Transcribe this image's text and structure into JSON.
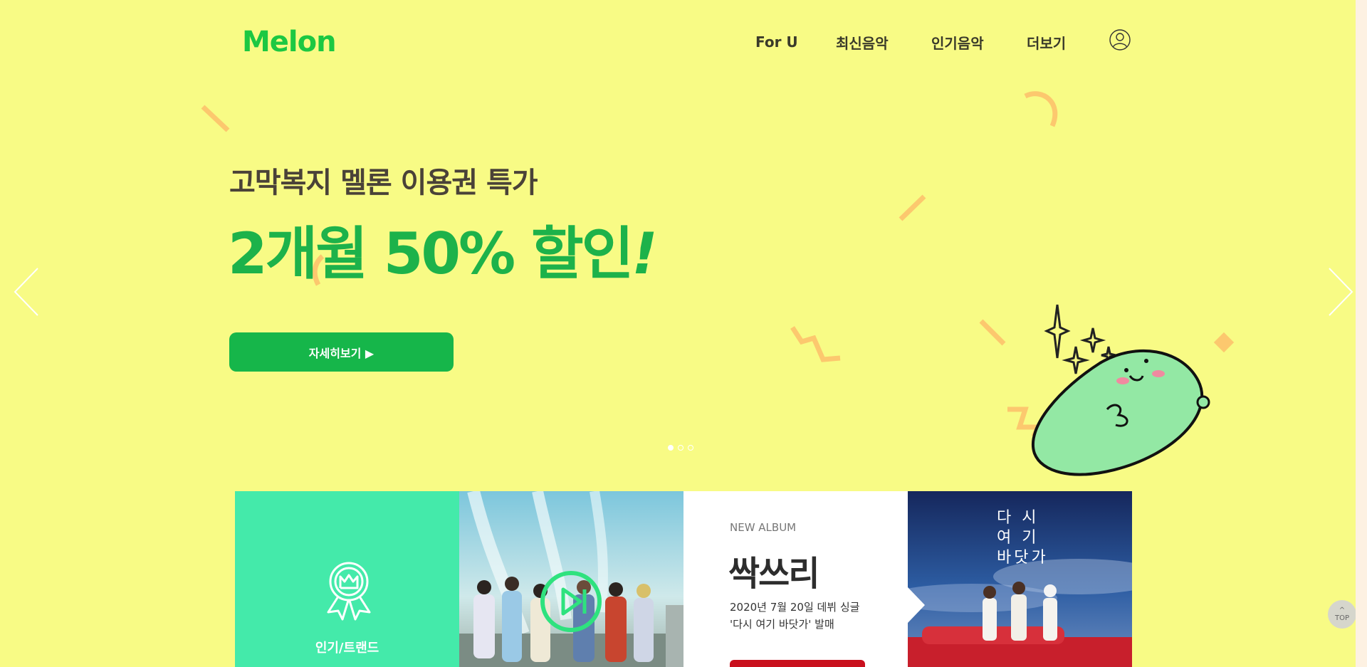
{
  "brand": {
    "logo": "Melon",
    "accent": "#1cc842",
    "bg": "#f8fb85"
  },
  "nav": {
    "items": [
      {
        "label": "For U"
      },
      {
        "label": "최신음악"
      },
      {
        "label": "인기음악"
      },
      {
        "label": "더보기"
      }
    ],
    "user_icon": "user-icon"
  },
  "hero": {
    "subtitle": "고막복지 멜론 이용권 특가",
    "headline": "2개월 50% 할인",
    "headline_bang": "!",
    "button": "자세히보기 ▶",
    "slides": 3,
    "active_slide": 1,
    "prev_icon": "chevron-left-icon",
    "next_icon": "chevron-right-icon"
  },
  "cards": {
    "trend": {
      "label": "인기/트랜드",
      "icon": "award-ribbon-icon",
      "color": "#44eaaa"
    },
    "video": {
      "icon": "play-pause-icon"
    },
    "new_album": {
      "tag": "NEW ALBUM",
      "title": "싹쓰리",
      "line1": "2020년 7월 20일 데뷔 싱글",
      "line2": "'다시 여기 바닷가' 발매",
      "button_color": "#c9101d"
    },
    "album_art": {
      "text_lines": [
        "다   시",
        "여   기",
        "바닷가"
      ]
    }
  },
  "top_button": {
    "arrow": "^",
    "label": "TOP"
  }
}
